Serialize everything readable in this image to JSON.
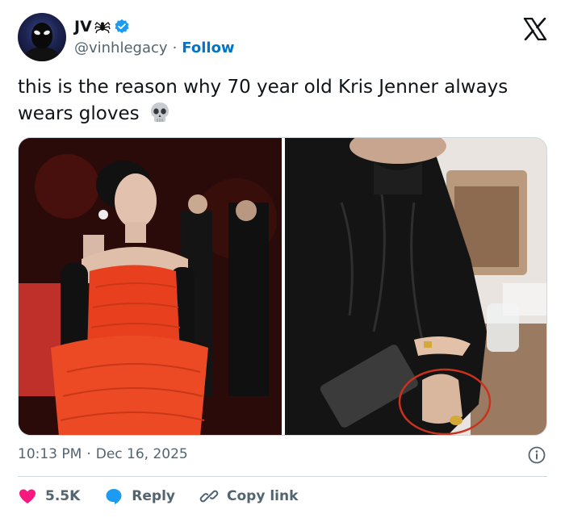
{
  "header": {
    "display_name": "JV",
    "handle": "@vinhlegacy",
    "separator": "·",
    "follow_label": "Follow",
    "icons": [
      "spider-icon",
      "verified-icon",
      "x-logo-icon"
    ],
    "verified_color": "#1d9bf0"
  },
  "tweet": {
    "text": "this is the reason why 70 year old Kris Jenner always wears gloves",
    "emoji": "skull-icon"
  },
  "media": {
    "count": 2,
    "images": [
      "photo-left",
      "photo-right"
    ]
  },
  "meta": {
    "time": "10:13 PM",
    "separator": "·",
    "date": "Dec 16, 2025",
    "icon": "info-icon"
  },
  "actions": {
    "likes": "5.5K",
    "reply_label": "Reply",
    "copy_label": "Copy link",
    "like_color": "#f91880",
    "reply_color": "#1d9bf0"
  }
}
